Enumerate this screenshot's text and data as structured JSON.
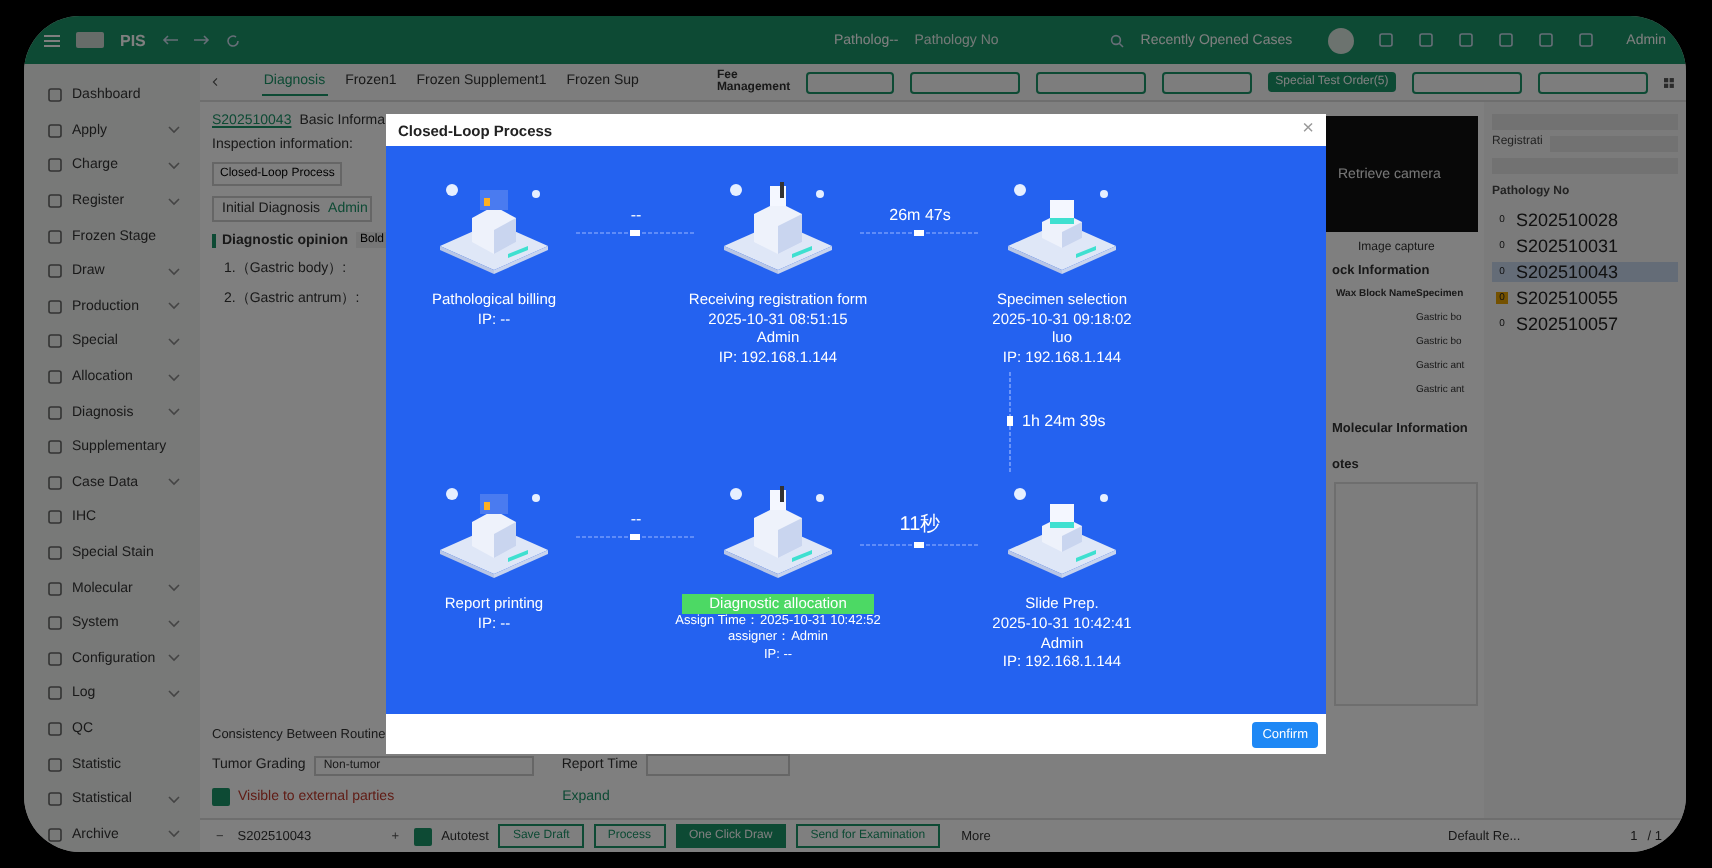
{
  "header": {
    "app_name": "PIS",
    "pathology_type": "Patholog--",
    "search_placeholder": "Pathology No",
    "recent_cases": "Recently Opened Cases",
    "user": "Admin"
  },
  "sidebar": {
    "items": [
      {
        "label": "Dashboard",
        "expandable": false
      },
      {
        "label": "Apply",
        "expandable": true
      },
      {
        "label": "Charge",
        "expandable": true
      },
      {
        "label": "Register",
        "expandable": true
      },
      {
        "label": "Frozen Stage",
        "expandable": false
      },
      {
        "label": "Draw",
        "expandable": true
      },
      {
        "label": "Production",
        "expandable": true
      },
      {
        "label": "Special",
        "expandable": true
      },
      {
        "label": "Allocation",
        "expandable": true
      },
      {
        "label": "Diagnosis",
        "expandable": true
      },
      {
        "label": "Supplementary",
        "expandable": false
      },
      {
        "label": "Case Data",
        "expandable": true
      },
      {
        "label": "IHC",
        "expandable": false
      },
      {
        "label": "Special Stain",
        "expandable": false
      },
      {
        "label": "Molecular",
        "expandable": true
      },
      {
        "label": "System",
        "expandable": true
      },
      {
        "label": "Configuration",
        "expandable": true
      },
      {
        "label": "Log",
        "expandable": true
      },
      {
        "label": "QC",
        "expandable": false
      },
      {
        "label": "Statistic",
        "expandable": false
      },
      {
        "label": "Statistical",
        "expandable": true
      },
      {
        "label": "Archive",
        "expandable": true
      }
    ]
  },
  "tabs": [
    {
      "label": "Diagnosis",
      "selected": true
    },
    {
      "label": "Frozen1",
      "selected": false
    },
    {
      "label": "Frozen Supplement1",
      "selected": false
    },
    {
      "label": "Frozen Sup",
      "selected": false
    }
  ],
  "toolbar": {
    "fee_management": "Fee Management",
    "special_test_order": "Special Test Order(5)"
  },
  "case": {
    "number": "S202510043",
    "basic_info": "Basic Informa",
    "inspection_info": "Inspection information:",
    "closed_loop": "Closed-Loop Process",
    "diagnosis_select": "Initial Diagnosis",
    "diagnosis_doctor": "Admin",
    "opinion_title": "Diagnostic opinion",
    "bold_button": "Bold",
    "opinion_lines": [
      "1.（Gastric body）:",
      "2.（Gastric antrum）:"
    ],
    "consistency_label": "Consistency Between Routine",
    "tumor_grading_label": "Tumor Grading",
    "tumor_grading_value": "Non-tumor",
    "report_time_label": "Report Time",
    "visible_external": {
      "label": "Visible to external parties",
      "checked": true
    },
    "expand": "Expand"
  },
  "right_panel": {
    "camera": "Retrieve camera",
    "image_capture": "Image capture",
    "block_title": "ock Information",
    "block_columns": [
      "Wax Block Name",
      "Specimen"
    ],
    "block_rows": [
      "Gastric bo",
      "Gastric bo",
      "Gastric ant",
      "Gastric ant"
    ],
    "molecular_title": "Molecular Information",
    "notes_title": "otes"
  },
  "case_list": {
    "filter": "Registrati",
    "column": "Pathology No",
    "items": [
      {
        "count": "0",
        "number": "S202510028",
        "selected": false,
        "flagged": false
      },
      {
        "count": "0",
        "number": "S202510031",
        "selected": false,
        "flagged": false
      },
      {
        "count": "0",
        "number": "S202510043",
        "selected": true,
        "flagged": false
      },
      {
        "count": "0",
        "number": "S202510055",
        "selected": false,
        "flagged": true
      },
      {
        "count": "0",
        "number": "S202510057",
        "selected": false,
        "flagged": false
      }
    ]
  },
  "bottom_bar": {
    "minus": "−",
    "case_number": "S202510043",
    "plus": "+",
    "autotest": {
      "label": "Autotest",
      "checked": true
    },
    "buttons": [
      {
        "label": "Save Draft",
        "primary": false
      },
      {
        "label": "Process",
        "primary": false
      },
      {
        "label": "One Click Draw",
        "primary": true
      },
      {
        "label": "Send for Examination",
        "primary": false
      }
    ],
    "more": "More",
    "default_report": "Default Re...",
    "page": "1",
    "page_total": "/ 1"
  },
  "dialog": {
    "title": "Closed-Loop Process",
    "close": "×",
    "steps": [
      {
        "name": "Pathological billing",
        "details": [
          "IP: --"
        ],
        "selected": false
      },
      {
        "name": "Receiving registration form",
        "details": [
          "2025-10-31 08:51:15",
          "Admin",
          "IP: 192.168.1.144"
        ],
        "selected": false
      },
      {
        "name": "Specimen selection",
        "details": [
          "2025-10-31 09:18:02",
          "luo",
          "IP: 192.168.1.144"
        ],
        "selected": false
      },
      {
        "name": "Report printing",
        "details": [
          "IP: --"
        ],
        "selected": false
      },
      {
        "name": "Diagnostic allocation",
        "details": [
          "Assign Time：2025-10-31 10:42:52",
          "assigner：Admin",
          "IP: --"
        ],
        "selected": true
      },
      {
        "name": "Slide Prep.",
        "details": [
          "2025-10-31 10:42:41",
          "Admin",
          "IP: 192.168.1.144"
        ],
        "selected": false
      }
    ],
    "intervals": [
      "--",
      "26m 47s",
      "1h 24m 39s",
      "--",
      "11秒"
    ],
    "confirm": "Confirm"
  }
}
